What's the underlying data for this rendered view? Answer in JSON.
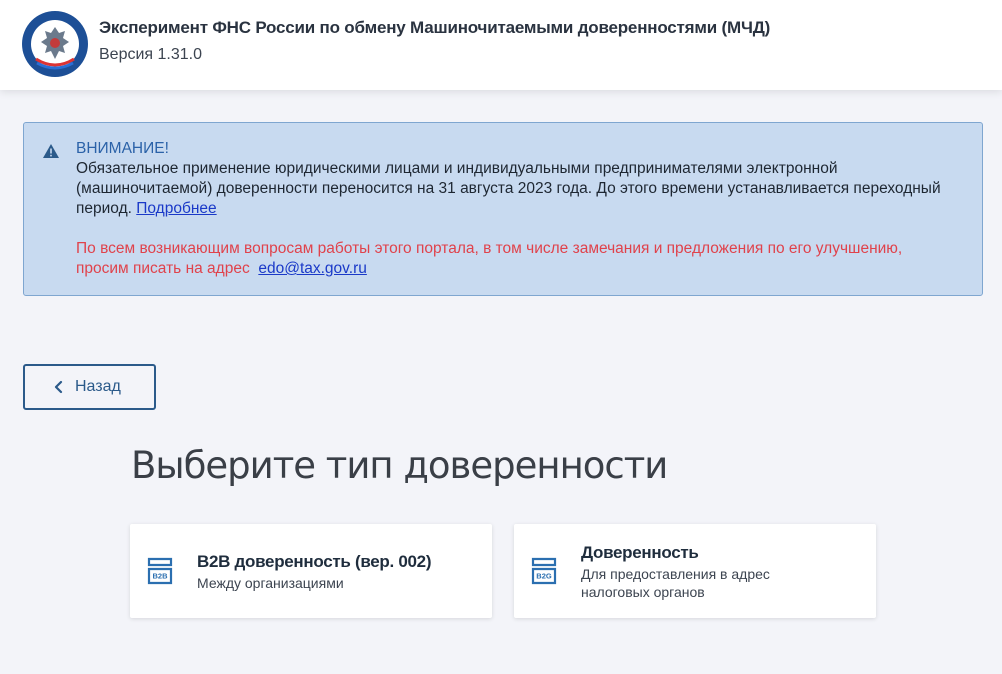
{
  "header": {
    "title": "Эксперимент ФНС России по обмену Машиночитаемыми доверенностями (МЧД)",
    "version": "Версия 1.31.0"
  },
  "notice": {
    "heading": "ВНИМАНИЕ!",
    "text": "Обязательное применение юридическими лицами и индивидуальными предпринимателями электронной (машиночитаемой) доверенности переносится на 31 августа 2023 года. До этого времени устанавливается переходный период.",
    "link": "Подробнее",
    "warning": "По всем возникающим вопросам работы этого портала, в том числе замечания и предложения по его улучшению, просим писать на адрес",
    "email": "edo@tax.gov.ru"
  },
  "back_button": {
    "label": "Назад"
  },
  "page_title": "Выберите тип доверенности",
  "cards": [
    {
      "icon_label": "B2B",
      "title": "B2B доверенность (вер. 002)",
      "subtitle": "Между организациями"
    },
    {
      "icon_label": "B2G",
      "title": "Доверенность",
      "subtitle": "Для предоставления в адрес налоговых органов"
    }
  ],
  "colors": {
    "accent": "#2b5a8a",
    "notice_bg": "#c8daf0",
    "warning": "#e0424b",
    "link": "#1a39c8"
  }
}
